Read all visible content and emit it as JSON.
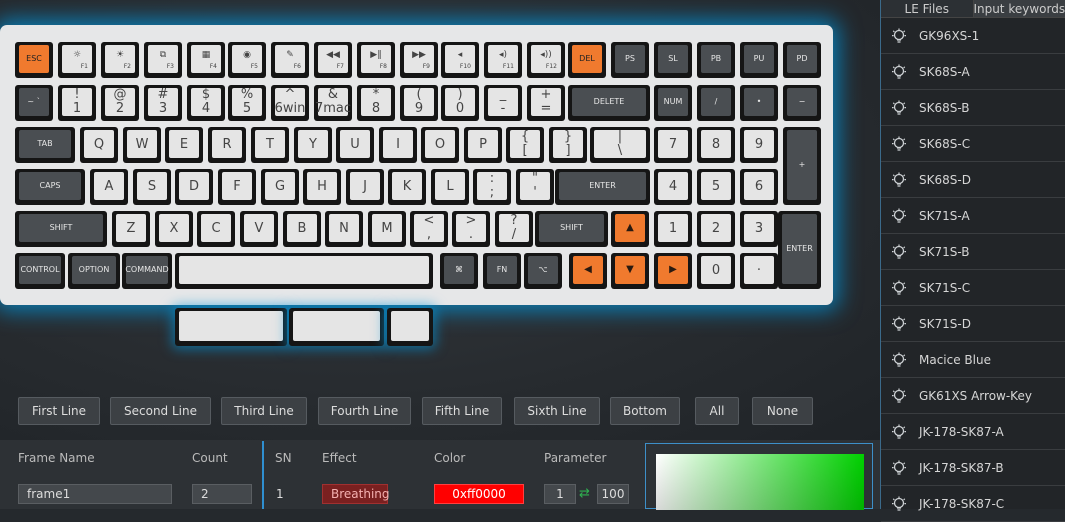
{
  "sidebar": {
    "tabs": [
      "LE Files",
      "Input keywords"
    ],
    "items": [
      "GK96XS-1",
      "SK68S-A",
      "SK68S-B",
      "SK68S-C",
      "SK68S-D",
      "SK71S-A",
      "SK71S-B",
      "SK71S-C",
      "SK71S-D",
      "Macice Blue",
      "GK61XS Arrow-Key",
      "JK-178-SK87-A",
      "JK-178-SK87-B",
      "JK-178-SK87-C"
    ]
  },
  "line_buttons": [
    "First Line",
    "Second Line",
    "Third Line",
    "Fourth Line",
    "Fifth Line",
    "Sixth Line",
    "Bottom",
    "All",
    "None"
  ],
  "frame_table": {
    "headers": [
      "Frame Name",
      "Count",
      "SN",
      "Effect",
      "Color",
      "Parameter"
    ],
    "row": {
      "frame_name": "frame1",
      "count": "2",
      "sn": "1",
      "effect": "Breathing",
      "color": "0xff0000",
      "param_a": "1",
      "param_b": "100"
    }
  },
  "colors": {
    "accent": "#2f8fd0",
    "orange_key": "#f07a2e",
    "glow": "#0096dc",
    "effect_bg": "#7a2020",
    "color_swatch": "#ff0000"
  },
  "keyboard": {
    "row1": [
      {
        "t": "ESC",
        "s": "orange"
      },
      {
        "t": "☼",
        "sub": "F1",
        "s": "fn"
      },
      {
        "t": "☀",
        "sub": "F2",
        "s": "fn"
      },
      {
        "t": "⧉",
        "sub": "F3",
        "s": "fn"
      },
      {
        "t": "▦",
        "sub": "F4",
        "s": "fn"
      },
      {
        "t": "◉",
        "sub": "F5",
        "s": "fn"
      },
      {
        "t": "✎",
        "sub": "F6",
        "s": "fn"
      },
      {
        "t": "◀◀",
        "sub": "F7",
        "s": "fn"
      },
      {
        "t": "▶‖",
        "sub": "F8",
        "s": "fn"
      },
      {
        "t": "▶▶",
        "sub": "F9",
        "s": "fn"
      },
      {
        "t": "◂",
        "sub": "F10",
        "s": "fn"
      },
      {
        "t": "◂)",
        "sub": "F11",
        "s": "fn"
      },
      {
        "t": "◂))",
        "sub": "F12",
        "s": "fn"
      },
      {
        "t": "DEL",
        "s": "orange"
      },
      {
        "t": "PS",
        "s": "dark"
      },
      {
        "t": "SL",
        "s": "dark"
      },
      {
        "t": "PB",
        "s": "dark"
      },
      {
        "t": "PU",
        "s": "dark"
      },
      {
        "t": "PD",
        "s": "dark"
      }
    ],
    "row2": [
      {
        "t": "~ `",
        "s": "dark"
      },
      {
        "t": "! 1",
        "s": "light"
      },
      {
        "t": "@ 2",
        "s": "light"
      },
      {
        "t": "# 3",
        "s": "light"
      },
      {
        "t": "$ 4",
        "s": "light"
      },
      {
        "t": "% 5",
        "s": "light"
      },
      {
        "t": "^ 6win",
        "s": "light"
      },
      {
        "t": "& 7mac",
        "s": "light"
      },
      {
        "t": "* 8",
        "s": "light"
      },
      {
        "t": "( 9",
        "s": "light"
      },
      {
        "t": ") 0",
        "s": "light"
      },
      {
        "t": "_ -",
        "s": "light"
      },
      {
        "t": "+ =",
        "s": "light"
      },
      {
        "t": "DELETE",
        "s": "dark"
      },
      {
        "t": "NUM",
        "s": "dark"
      },
      {
        "t": "/",
        "s": "dark"
      },
      {
        "t": "•",
        "s": "dark"
      },
      {
        "t": "−",
        "s": "dark"
      }
    ],
    "row3": [
      {
        "t": "TAB",
        "s": "dark"
      },
      {
        "t": "Q",
        "s": "light"
      },
      {
        "t": "W",
        "s": "light"
      },
      {
        "t": "E",
        "s": "light"
      },
      {
        "t": "R",
        "s": "light"
      },
      {
        "t": "T",
        "s": "light"
      },
      {
        "t": "Y",
        "s": "light"
      },
      {
        "t": "U",
        "s": "light"
      },
      {
        "t": "I",
        "s": "light"
      },
      {
        "t": "O",
        "s": "light"
      },
      {
        "t": "P",
        "s": "light"
      },
      {
        "t": "{ [",
        "s": "light"
      },
      {
        "t": "} ]",
        "s": "light"
      },
      {
        "t": "| \\",
        "s": "light"
      },
      {
        "t": "7",
        "s": "light"
      },
      {
        "t": "8",
        "s": "light"
      },
      {
        "t": "9",
        "s": "light"
      },
      {
        "t": "+",
        "s": "dark"
      }
    ],
    "row4": [
      {
        "t": "CAPS",
        "s": "dark"
      },
      {
        "t": "A",
        "s": "light"
      },
      {
        "t": "S",
        "s": "light"
      },
      {
        "t": "D",
        "s": "light"
      },
      {
        "t": "F",
        "s": "light"
      },
      {
        "t": "G",
        "s": "light"
      },
      {
        "t": "H",
        "s": "light"
      },
      {
        "t": "J",
        "s": "light"
      },
      {
        "t": "K",
        "s": "light"
      },
      {
        "t": "L",
        "s": "light"
      },
      {
        "t": ": ;",
        "s": "light"
      },
      {
        "t": "\" '",
        "s": "light"
      },
      {
        "t": "ENTER",
        "s": "dark"
      },
      {
        "t": "4",
        "s": "light"
      },
      {
        "t": "5",
        "s": "light"
      },
      {
        "t": "6",
        "s": "light"
      }
    ],
    "row5": [
      {
        "t": "SHIFT",
        "s": "dark"
      },
      {
        "t": "Z",
        "s": "light"
      },
      {
        "t": "X",
        "s": "light"
      },
      {
        "t": "C",
        "s": "light"
      },
      {
        "t": "V",
        "s": "light"
      },
      {
        "t": "B",
        "s": "light"
      },
      {
        "t": "N",
        "s": "light"
      },
      {
        "t": "M",
        "s": "light"
      },
      {
        "t": "< ,",
        "s": "light"
      },
      {
        "t": "> .",
        "s": "light"
      },
      {
        "t": "? /",
        "s": "light"
      },
      {
        "t": "SHIFT",
        "s": "dark"
      },
      {
        "t": "▲",
        "s": "orange arrow"
      },
      {
        "t": "1",
        "s": "light"
      },
      {
        "t": "2",
        "s": "light"
      },
      {
        "t": "3",
        "s": "light"
      },
      {
        "t": "ENTER",
        "s": "dark"
      }
    ],
    "row6": [
      {
        "t": "CONTROL",
        "s": "dark"
      },
      {
        "t": "OPTION",
        "s": "dark"
      },
      {
        "t": "COMMAND",
        "s": "dark"
      },
      {
        "t": "",
        "s": "light"
      },
      {
        "t": "⌘",
        "s": "dark"
      },
      {
        "t": "FN",
        "s": "dark"
      },
      {
        "t": "⌥",
        "s": "dark"
      },
      {
        "t": "◀",
        "s": "orange arrow"
      },
      {
        "t": "▼",
        "s": "orange arrow"
      },
      {
        "t": "▶",
        "s": "orange arrow"
      },
      {
        "t": "0",
        "s": "light"
      },
      {
        "t": "·",
        "s": "light"
      }
    ],
    "extra": [
      {
        "t": "",
        "s": "light"
      },
      {
        "t": "",
        "s": "light"
      },
      {
        "t": "",
        "s": "light"
      }
    ]
  }
}
